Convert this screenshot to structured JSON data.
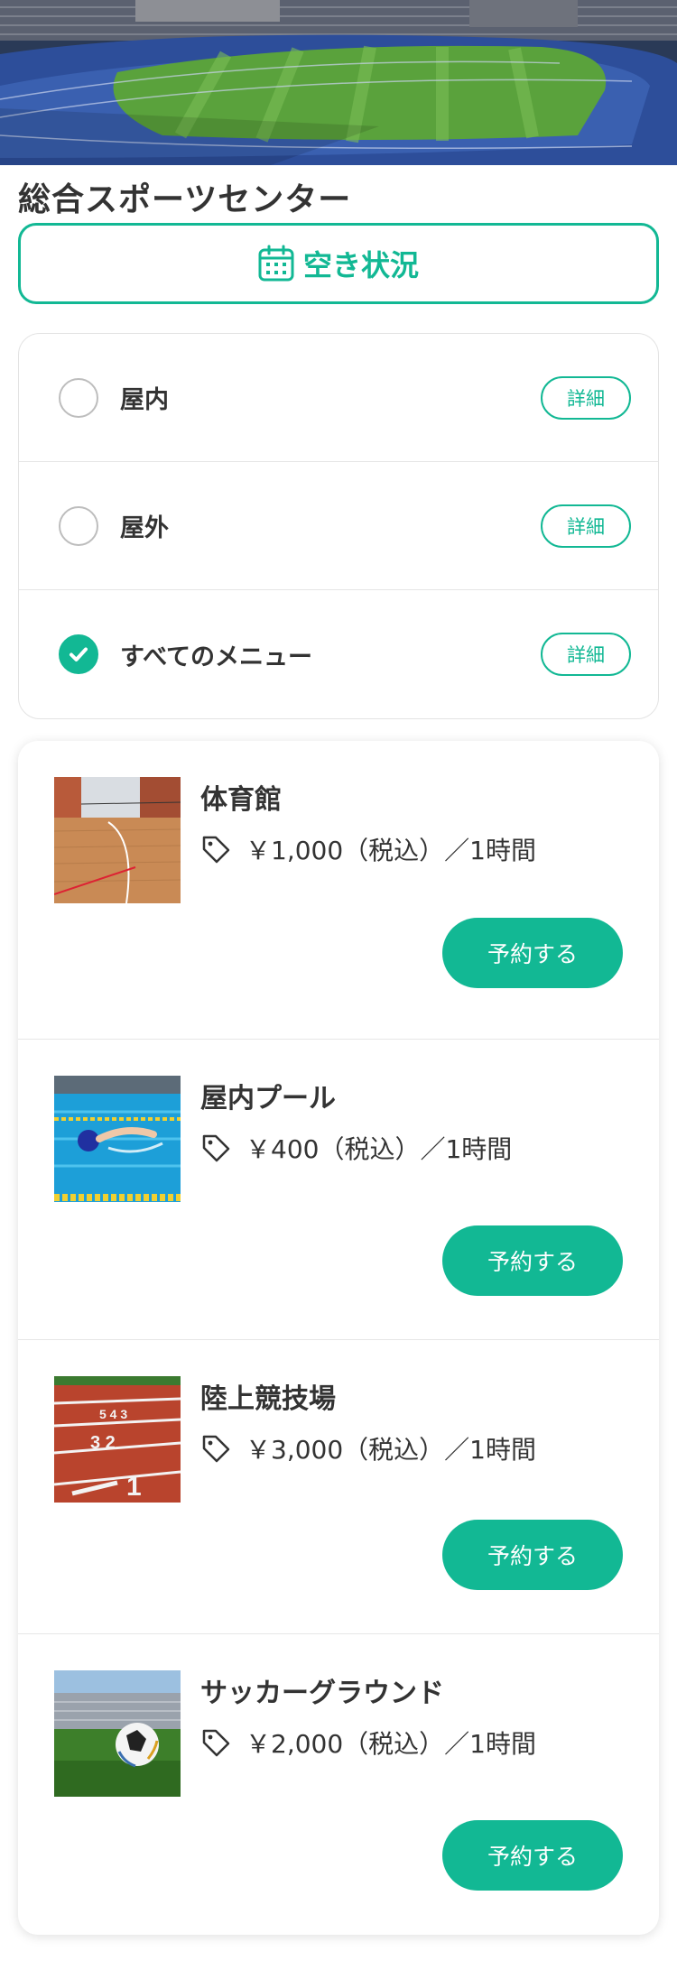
{
  "facility": {
    "name": "総合スポーツセンター"
  },
  "availability": {
    "label": "空き状況",
    "icon": "calendar-icon"
  },
  "filters": [
    {
      "label": "屋内",
      "checked": false,
      "detail_label": "詳細"
    },
    {
      "label": "屋外",
      "checked": false,
      "detail_label": "詳細"
    },
    {
      "label": "すべてのメニュー",
      "checked": true,
      "detail_label": "詳細"
    }
  ],
  "menus": [
    {
      "title": "体育館",
      "price": "￥1,000（税込）／1時間",
      "reserve_label": "予約する",
      "image": "gymnasium"
    },
    {
      "title": "屋内プール",
      "price": "￥400（税込）／1時間",
      "reserve_label": "予約する",
      "image": "indoor-pool"
    },
    {
      "title": "陸上競技場",
      "price": "￥3,000（税込）／1時間",
      "reserve_label": "予約する",
      "image": "athletics-track"
    },
    {
      "title": "サッカーグラウンド",
      "price": "￥2,000（税込）／1時間",
      "reserve_label": "予約する",
      "image": "soccer-field"
    }
  ],
  "colors": {
    "accent": "#12b894",
    "text": "#333333",
    "border": "#e3e3e3"
  }
}
